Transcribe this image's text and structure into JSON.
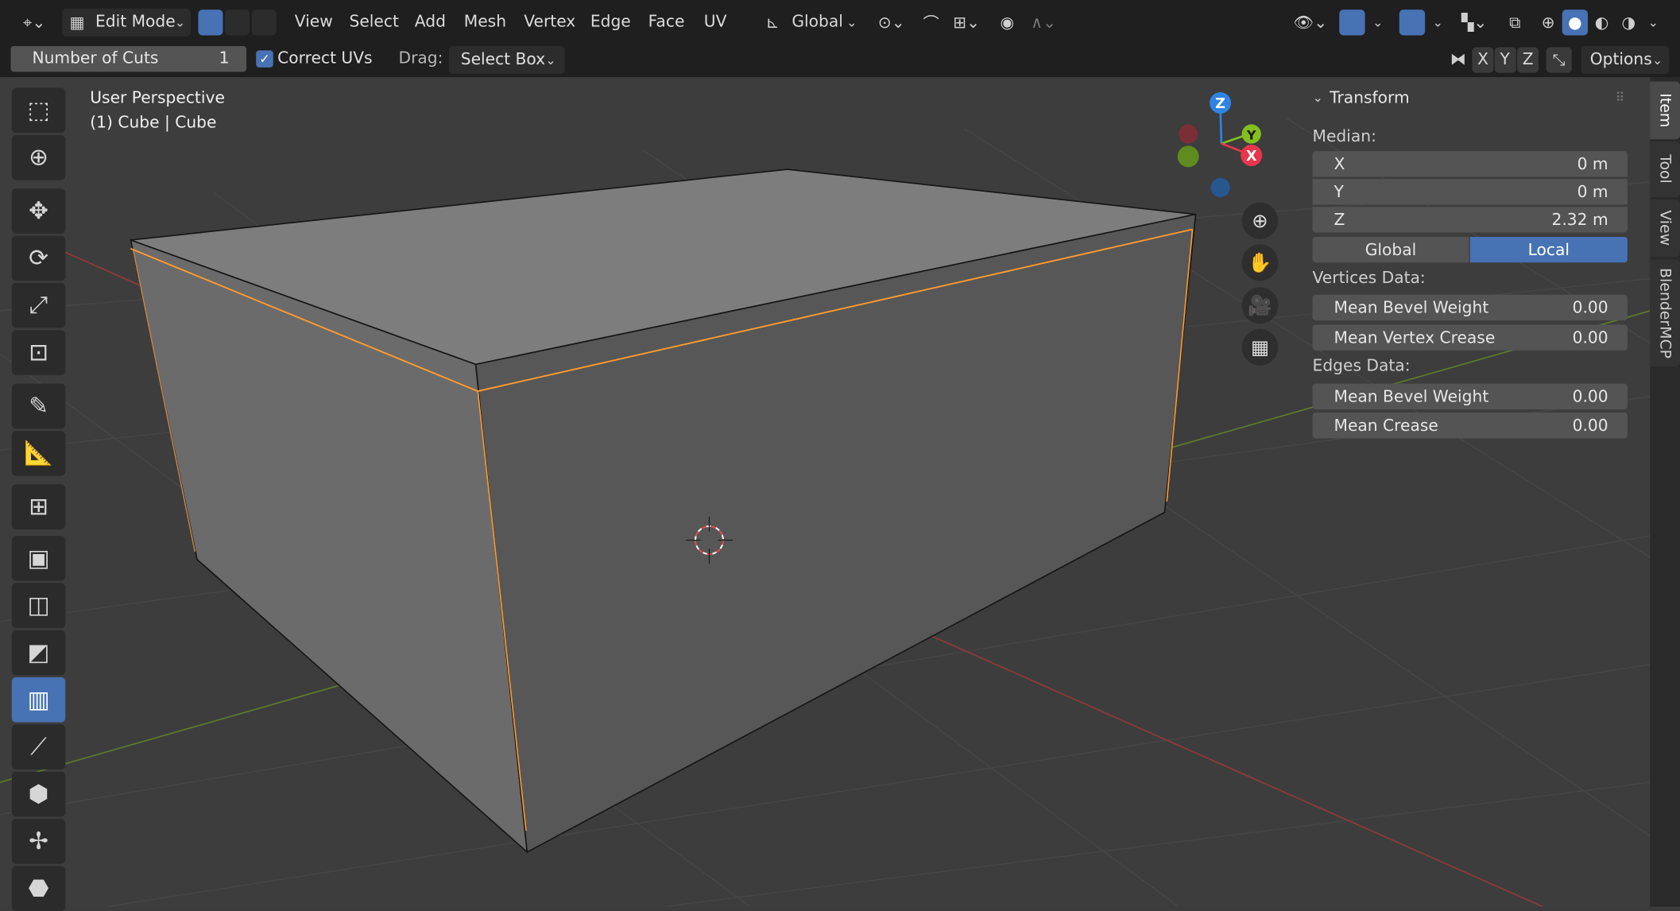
{
  "header": {
    "mode_label": "Edit Mode",
    "menus": [
      "View",
      "Select",
      "Add",
      "Mesh",
      "Vertex",
      "Edge",
      "Face",
      "UV"
    ],
    "transform_orientation": "Global"
  },
  "tool_options": {
    "cuts_label": "Number of Cuts",
    "cuts_value": "1",
    "correct_uvs_label": "Correct UVs",
    "drag_label": "Drag:",
    "drag_value": "Select Box",
    "axis_x": "X",
    "axis_y": "Y",
    "axis_z": "Z",
    "options_label": "Options"
  },
  "viewport": {
    "perspective": "User Perspective",
    "object_info": "(1) Cube | Cube",
    "gizmo": {
      "z": "Z",
      "y": "Y",
      "x": "X"
    }
  },
  "npanel": {
    "title": "Transform",
    "median_label": "Median:",
    "fields": [
      {
        "label": "X",
        "value": "0 m"
      },
      {
        "label": "Y",
        "value": "0 m"
      },
      {
        "label": "Z",
        "value": "2.32 m"
      }
    ],
    "space_global": "Global",
    "space_local": "Local",
    "vertices_label": "Vertices Data:",
    "vertex_fields": [
      {
        "label": "Mean Bevel Weight",
        "value": "0.00"
      },
      {
        "label": "Mean Vertex Crease",
        "value": "0.00"
      }
    ],
    "edges_label": "Edges Data:",
    "edge_fields": [
      {
        "label": "Mean Bevel Weight",
        "value": "0.00"
      },
      {
        "label": "Mean Crease",
        "value": "0.00"
      }
    ]
  },
  "side_tabs": [
    "Item",
    "Tool",
    "View",
    "BlenderMCP"
  ],
  "colors": {
    "accent": "#4772b3",
    "selected_edge": "#ff9b2e",
    "axis_x": "#e8364c",
    "axis_y": "#83c01f",
    "axis_z": "#2f83e3"
  }
}
